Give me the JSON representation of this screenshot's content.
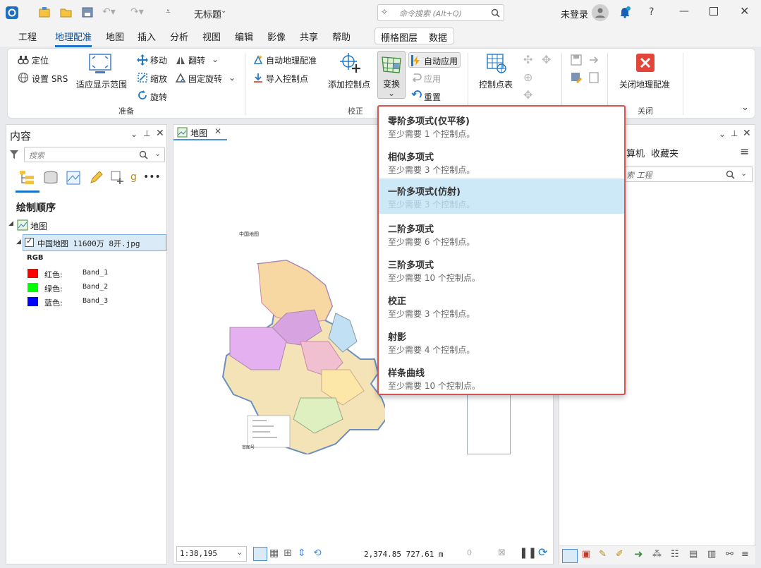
{
  "titlebar": {
    "doc_title": "无标题",
    "command_search_placeholder": "命令搜索 (Alt+Q)",
    "user_status": "未登录",
    "help": "?"
  },
  "menubar": {
    "items": [
      "工程",
      "地理配准",
      "地图",
      "插入",
      "分析",
      "视图",
      "编辑",
      "影像",
      "共享",
      "帮助"
    ],
    "context_tabs": [
      "栅格图层",
      "数据"
    ]
  },
  "ribbon": {
    "prepare": {
      "locate": "定位",
      "set_srs": "设置 SRS",
      "fit_display": "适应显示范围",
      "move": "移动",
      "scale": "缩放",
      "rotate": "旋转",
      "flip": "翻转",
      "fixed_rotate": "固定旋转",
      "label": "准备"
    },
    "adjust": {
      "auto_georef": "自动地理配准",
      "import_cp": "导入控制点",
      "add_cp": "添加控制点",
      "transform": "变换",
      "auto_apply": "自动应用",
      "apply": "应用",
      "reset": "重置",
      "label": "校正"
    },
    "review": {
      "cp_table": "控制点表"
    },
    "close": {
      "close_georef": "关闭地理配准",
      "label": "关闭"
    }
  },
  "transform_menu": {
    "items": [
      {
        "title": "零阶多项式(仅平移)",
        "desc": "至少需要 1 个控制点。"
      },
      {
        "title": "相似多项式",
        "desc": "至少需要 3 个控制点。"
      },
      {
        "title": "一阶多项式(仿射)",
        "desc": "至少需要 3 个控制点。"
      },
      {
        "title": "二阶多项式",
        "desc": "至少需要 6 个控制点。"
      },
      {
        "title": "三阶多项式",
        "desc": "至少需要 10 个控制点。"
      },
      {
        "title": "校正",
        "desc": "至少需要 3 个控制点。"
      },
      {
        "title": "射影",
        "desc": "至少需要 4 个控制点。"
      },
      {
        "title": "样条曲线",
        "desc": "至少需要 10 个控制点。"
      }
    ],
    "highlighted_index": 2
  },
  "contents": {
    "title": "内容",
    "search_placeholder": "搜索",
    "draw_order": "绘制顺序",
    "map_name": "地图",
    "layer_name": "中国地图 11600万 8开.jpg",
    "rgb_label": "RGB",
    "bands": [
      {
        "channel": "红色:",
        "band": "Band_1",
        "color": "#ff0000"
      },
      {
        "channel": "绿色:",
        "band": "Band_2",
        "color": "#00ff00"
      },
      {
        "channel": "蓝色:",
        "band": "Band_3",
        "color": "#0000ff"
      }
    ]
  },
  "map_view": {
    "tab_label": "地图",
    "map_caption": "中国地图",
    "scale": "1:38,195",
    "coords": "2,374.85 727.61 m",
    "sel_count": "0"
  },
  "catalog": {
    "tabs": [
      "算机",
      "收藏夹"
    ],
    "search_placeholder": "索 工程"
  }
}
